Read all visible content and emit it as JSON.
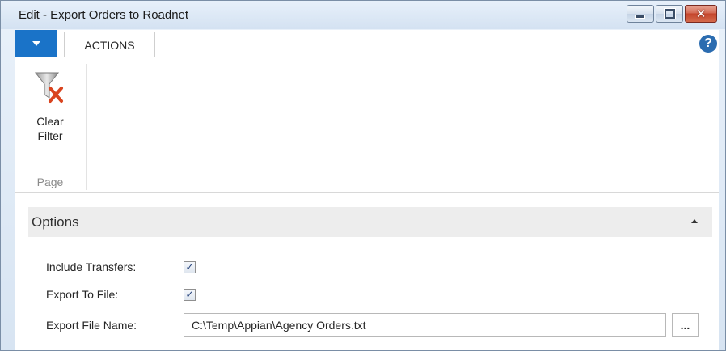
{
  "window": {
    "title": "Edit - Export Orders to Roadnet",
    "minimize_icon": "minimize-icon",
    "maximize_icon": "maximize-icon",
    "close_icon": "close-icon",
    "close_glyph": "✕"
  },
  "ribbon": {
    "app_menu_icon": "dropdown-arrow-icon",
    "tabs": [
      {
        "label": "ACTIONS"
      }
    ],
    "help_glyph": "?",
    "groups": [
      {
        "label": "Page",
        "buttons": [
          {
            "label_line1": "Clear",
            "label_line2": "Filter",
            "icon": "clear-filter-icon"
          }
        ]
      }
    ]
  },
  "options": {
    "title": "Options",
    "collapse_icon": "chevron-up-icon",
    "fields": [
      {
        "label": "Include Transfers:",
        "type": "checkbox",
        "checked": true
      },
      {
        "label": "Export To File:",
        "type": "checkbox",
        "checked": true
      },
      {
        "label": "Export File Name:",
        "type": "text",
        "value": "C:\\Temp\\Appian\\Agency Orders.txt",
        "lookup_label": "..."
      }
    ]
  },
  "colors": {
    "accent": "#1a73c8",
    "close_button": "#c4452c",
    "fasttab_bg": "#ededed"
  }
}
